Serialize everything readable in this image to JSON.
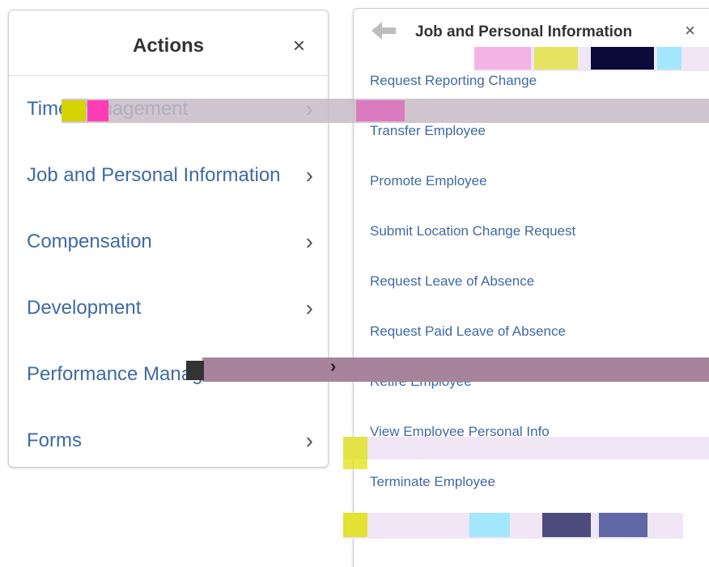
{
  "actions": {
    "title": "Actions",
    "close_glyph": "×",
    "items": [
      {
        "label": "Time Management"
      },
      {
        "label": "Job and Personal Information"
      },
      {
        "label": "Compensation"
      },
      {
        "label": "Development"
      },
      {
        "label": "Performance Management"
      },
      {
        "label": "Forms"
      }
    ]
  },
  "job_panel": {
    "title": "Job and Personal Information",
    "close_glyph": "×",
    "back_icon": "back-arrow-icon",
    "items": [
      {
        "label": "Request Reporting Change"
      },
      {
        "label": "Transfer Employee"
      },
      {
        "label": "Promote Employee"
      },
      {
        "label": "Submit Location Change Request"
      },
      {
        "label": "Request Leave of Absence"
      },
      {
        "label": "Request Paid Leave of Absence"
      },
      {
        "label": "Retire Employee"
      },
      {
        "label": "View Employee Personal Info"
      },
      {
        "label": "Terminate Employee"
      }
    ]
  },
  "colors": {
    "link": "#3f6aa3",
    "glitch_band": "#a7849b",
    "glitch_light": "#f0e6f6"
  }
}
